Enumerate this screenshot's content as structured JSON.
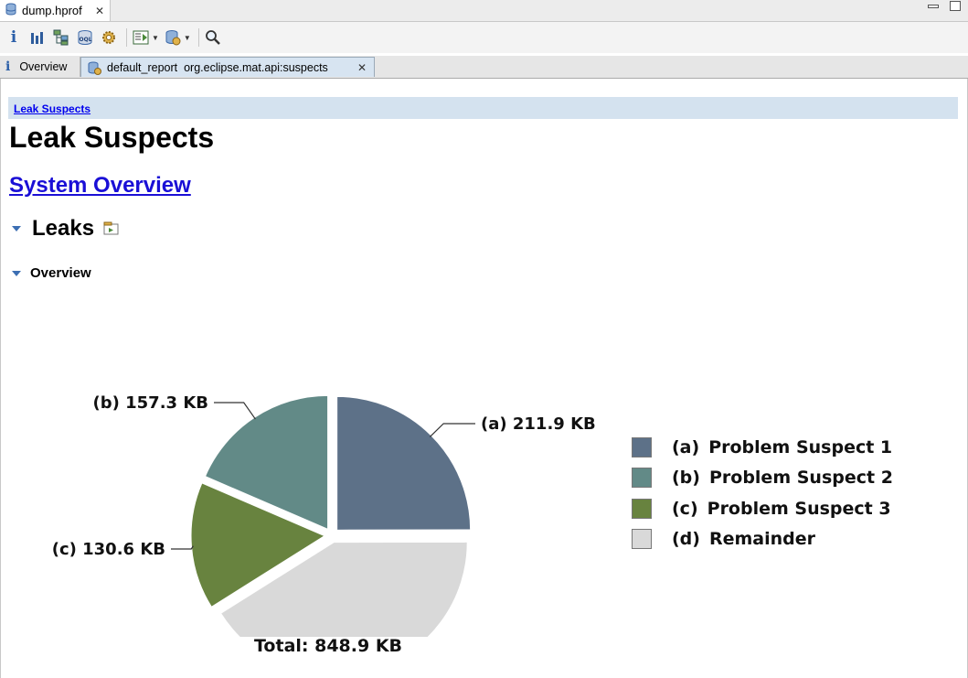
{
  "editor_tab": {
    "label": "dump.hprof"
  },
  "toolbar": {
    "buttons": [
      "info-icon",
      "histogram-icon",
      "dominator-tree-icon",
      "oql-icon",
      "thread-overview-icon",
      "reports-icon",
      "heap-dump-actions-icon",
      "search-icon"
    ]
  },
  "inner_tabs": {
    "overview": "Overview",
    "report": "default_report  org.eclipse.mat.api:suspects"
  },
  "page": {
    "breadcrumb": "Leak Suspects",
    "title": "Leak Suspects",
    "system_overview_link": "System Overview",
    "leaks_heading": "Leaks",
    "overview_heading": "Overview"
  },
  "chart_data": {
    "type": "pie",
    "unit": "KB",
    "slices": [
      {
        "key": "(a)",
        "label": "Problem Suspect 1",
        "value": 211.9,
        "value_label": "211.9 KB",
        "color": "#5d7188"
      },
      {
        "key": "(b)",
        "label": "Problem Suspect 2",
        "value": 157.3,
        "value_label": "157.3 KB",
        "color": "#628a87"
      },
      {
        "key": "(c)",
        "label": "Problem Suspect 3",
        "value": 130.6,
        "value_label": "130.6 KB",
        "color": "#68833f"
      },
      {
        "key": "(d)",
        "label": "Remainder",
        "value": 348.9,
        "value_label": "348.9 KB",
        "color": "#d9d9d9"
      }
    ],
    "total_label": "Total: 848.9 KB",
    "legend_position": "right"
  }
}
